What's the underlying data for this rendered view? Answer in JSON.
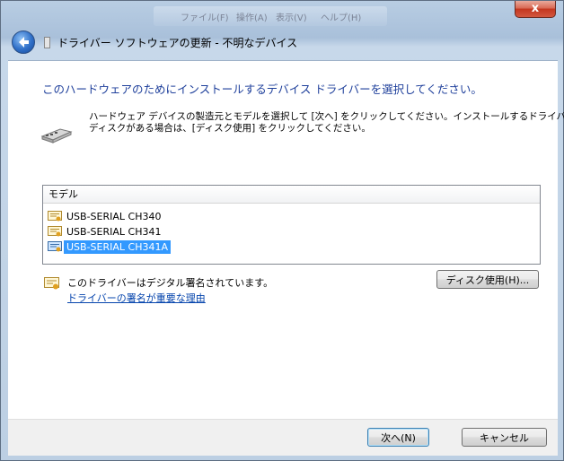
{
  "window": {
    "title": "ドライバー ソフトウェアの更新 - 不明なデバイス",
    "close_label": "x"
  },
  "background_hint": {
    "items": [
      "ファイル(F)",
      "操作(A)",
      "表示(V)",
      "ヘルプ(H)"
    ]
  },
  "content": {
    "heading": "このハードウェアのためにインストールするデバイス ドライバーを選択してください。",
    "description_line1": "ハードウェア デバイスの製造元とモデルを選択して [次へ] をクリックしてください。インストールするドライバーの",
    "description_line2": "ディスクがある場合は、[ディスク使用] をクリックしてください。"
  },
  "model_list": {
    "header": "モデル",
    "items": [
      {
        "label": "USB-SERIAL CH340",
        "selected": false
      },
      {
        "label": "USB-SERIAL CH341",
        "selected": false
      },
      {
        "label": "USB-SERIAL CH341A",
        "selected": true
      }
    ]
  },
  "signature": {
    "text": "このドライバーはデジタル署名されています。",
    "link": "ドライバーの署名が重要な理由"
  },
  "buttons": {
    "have_disk": "ディスク使用(H)...",
    "next": "次へ(N)",
    "cancel": "キャンセル"
  },
  "colors": {
    "heading": "#1e3f9b",
    "selection": "#3399ff",
    "link": "#0645ad"
  }
}
